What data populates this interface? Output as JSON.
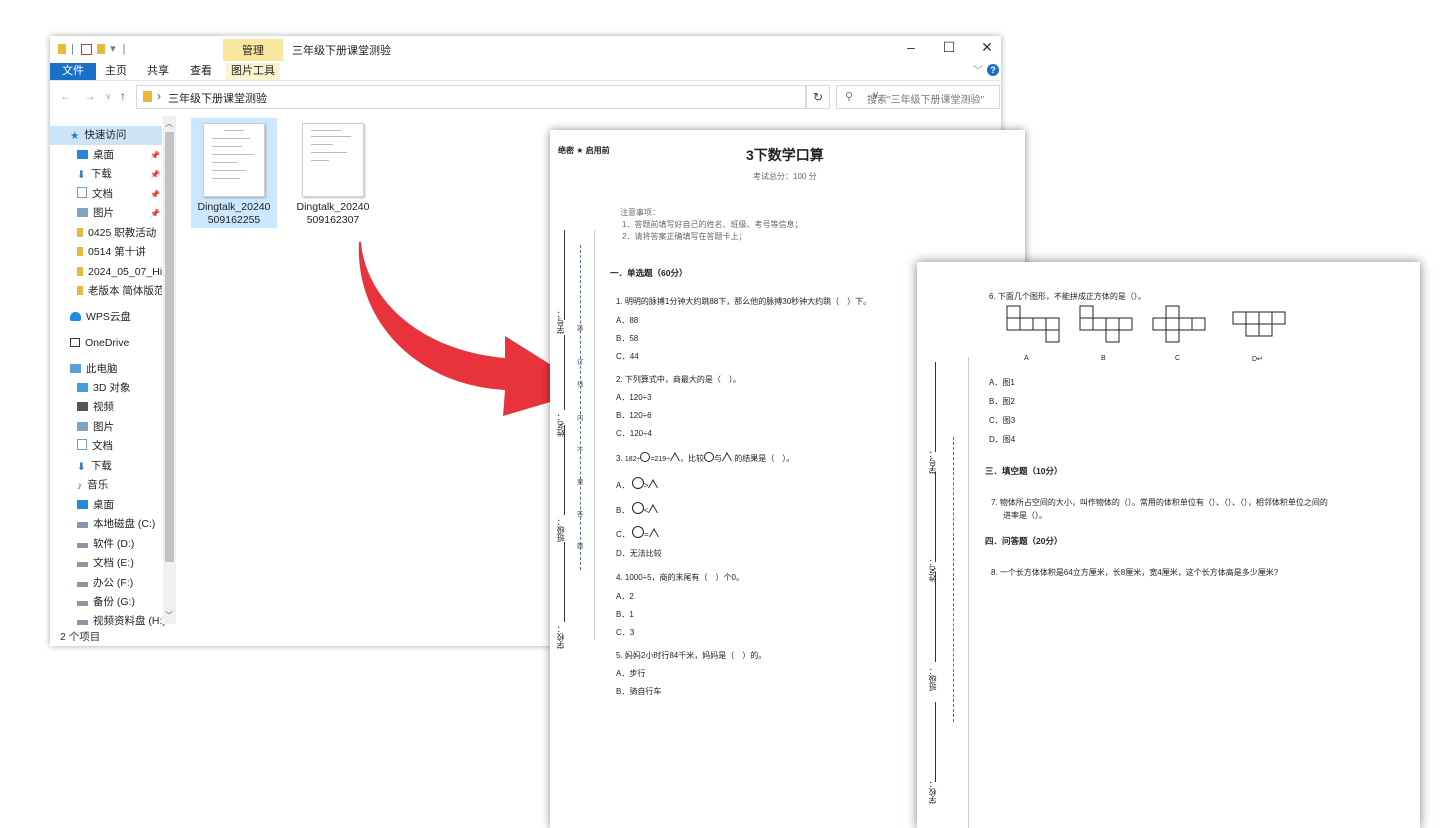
{
  "window": {
    "title": "三年级下册课堂测验",
    "manage_tab": "管理",
    "controls": [
      "–",
      "☐",
      "✕"
    ],
    "ribbon_tabs": [
      "文件",
      "主页",
      "共享",
      "查看",
      "图片工具"
    ],
    "help": "?"
  },
  "address": {
    "path": "三年级下册课堂测验",
    "search_placeholder": "搜索\"三年级下册课堂测验\""
  },
  "sidebar": {
    "items": [
      {
        "label": "快速访问",
        "icon": "star-icon"
      },
      {
        "label": "桌面",
        "icon": "desktop-icon"
      },
      {
        "label": "下载",
        "icon": "download-icon"
      },
      {
        "label": "文档",
        "icon": "document-icon"
      },
      {
        "label": "图片",
        "icon": "pictures-icon"
      },
      {
        "label": "0425 职教活动",
        "icon": "folder-icon"
      },
      {
        "label": "0514 第十讲",
        "icon": "folder-icon"
      },
      {
        "label": "2024_05_07_Hi",
        "icon": "folder-icon"
      },
      {
        "label": "老版本 简体版范",
        "icon": "folder-icon"
      },
      {
        "label": "WPS云盘",
        "icon": "cloud-icon"
      },
      {
        "label": "OneDrive",
        "icon": "onedrive-icon"
      },
      {
        "label": "此电脑",
        "icon": "computer-icon"
      },
      {
        "label": "3D 对象",
        "icon": "3d-objects-icon"
      },
      {
        "label": "视频",
        "icon": "video-icon"
      },
      {
        "label": "图片",
        "icon": "pictures-icon"
      },
      {
        "label": "文档",
        "icon": "document-icon"
      },
      {
        "label": "下载",
        "icon": "download-icon"
      },
      {
        "label": "音乐",
        "icon": "music-icon"
      },
      {
        "label": "桌面",
        "icon": "desktop-icon"
      },
      {
        "label": "本地磁盘 (C:)",
        "icon": "drive-icon"
      },
      {
        "label": "软件 (D:)",
        "icon": "drive-icon"
      },
      {
        "label": "文档 (E:)",
        "icon": "drive-icon"
      },
      {
        "label": "办公 (F:)",
        "icon": "drive-icon"
      },
      {
        "label": "备份 (G:)",
        "icon": "drive-icon"
      },
      {
        "label": "视频资料盘 (H:)",
        "icon": "drive-icon"
      }
    ]
  },
  "files": [
    {
      "name_line1": "Dingtalk_20240",
      "name_line2": "509162255",
      "selected": true
    },
    {
      "name_line1": "Dingtalk_20240",
      "name_line2": "509162307",
      "selected": false
    }
  ],
  "status": "2 个项目",
  "exam_page1": {
    "secret": "绝密 ★ 启用前",
    "title": "3下数学口算",
    "total": "考试总分：100 分",
    "notice_title": "注意事项：",
    "notice1": "1．答题前填写好自己的姓名、班级、考号等信息；",
    "notice2": "2．请将答案正确填写在答题卡上；",
    "section1": "一．单选题（60分）",
    "q1": "1. 明明的脉搏1分钟大约跳88下，那么他的脉搏30秒钟大约跳（　）下。",
    "q1a": "A．88",
    "q1b": "B．58",
    "q1c": "C．44",
    "q2": "2. 下列算式中，商最大的是（　）。",
    "q2a": "A．120÷3",
    "q2b": "B．120÷6",
    "q2c": "C．120÷4",
    "q3_prefix": "3.",
    "q3_p1": "182÷",
    "q3_p2": "=219÷",
    "q3_p3": "，比较",
    "q3_p4": "与",
    "q3_p5": "的结果是（　）。",
    "q3a": "A．",
    "q3b": "B．",
    "q3c": "C．",
    "q3d": "D．无法比较",
    "q3a_op": ">",
    "q3b_op": "<",
    "q3c_op": "=",
    "q4": "4. 1000÷5，商的末尾有（　）个0。",
    "q4a": "A．2",
    "q4b": "B．1",
    "q4c": "C．3",
    "q5": "5. 妈妈2小时行84千米，妈妈是（　）的。",
    "q5a": "A．步行",
    "q5b": "B．骑自行车",
    "margin_labels": [
      "学号：",
      "姓名：",
      "班级：",
      "学校："
    ],
    "margin_marks": [
      "装",
      "订",
      "线",
      "内",
      "不",
      "要",
      "答",
      "题"
    ]
  },
  "exam_page2": {
    "q6": "6. 下面几个图形，不能拼成正方体的是（）。",
    "fig_labels": [
      "A",
      "B",
      "C",
      "D↵"
    ],
    "q6a": "A．图1",
    "q6b": "B．图2",
    "q6c": "C．图3",
    "q6d": "D．图4",
    "section3": "三．填空题（10分）",
    "q7_line1": "7. 物体所占空间的大小，叫作物体的（）。常用的体积单位有（）、（）、（），相邻体积单位之间的",
    "q7_line2": "进率是（）。",
    "section4": "四．问答题（20分）",
    "q8": "8. 一个长方体体积是64立方厘米，长8厘米，宽4厘米，这个长方体高是多少厘米?",
    "margin_labels": [
      "学号：",
      "姓名：",
      "班级：",
      "学校："
    ]
  },
  "colors": {
    "accent": "#1a6fc6",
    "selection": "#cce8ff",
    "arrow": "#e8323c",
    "manage": "#f8e79c"
  }
}
